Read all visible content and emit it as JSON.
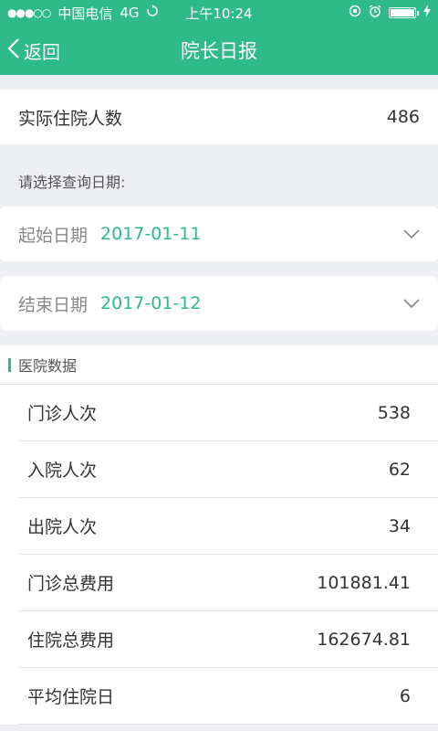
{
  "status_bar": {
    "carrier": "中国电信",
    "network": "4G",
    "time": "上午10:24",
    "signal": "●●●○○"
  },
  "nav": {
    "back_label": "返回",
    "title": "院长日报"
  },
  "inpatients": {
    "label": "实际住院人数",
    "value": "486"
  },
  "date_hint": "请选择查询日期:",
  "start_date": {
    "label": "起始日期",
    "value": "2017-01-11"
  },
  "end_date": {
    "label": "结束日期",
    "value": "2017-01-12"
  },
  "section": {
    "title": "医院数据"
  },
  "rows": [
    {
      "label": "门诊人次",
      "value": "538"
    },
    {
      "label": "入院人次",
      "value": "62"
    },
    {
      "label": "出院人次",
      "value": "34"
    },
    {
      "label": "门诊总费用",
      "value": "101881.41"
    },
    {
      "label": "住院总费用",
      "value": "162674.81"
    },
    {
      "label": "平均住院日",
      "value": "6"
    }
  ],
  "colors": {
    "accent": "#2fba8a",
    "background": "#eeeff3"
  }
}
